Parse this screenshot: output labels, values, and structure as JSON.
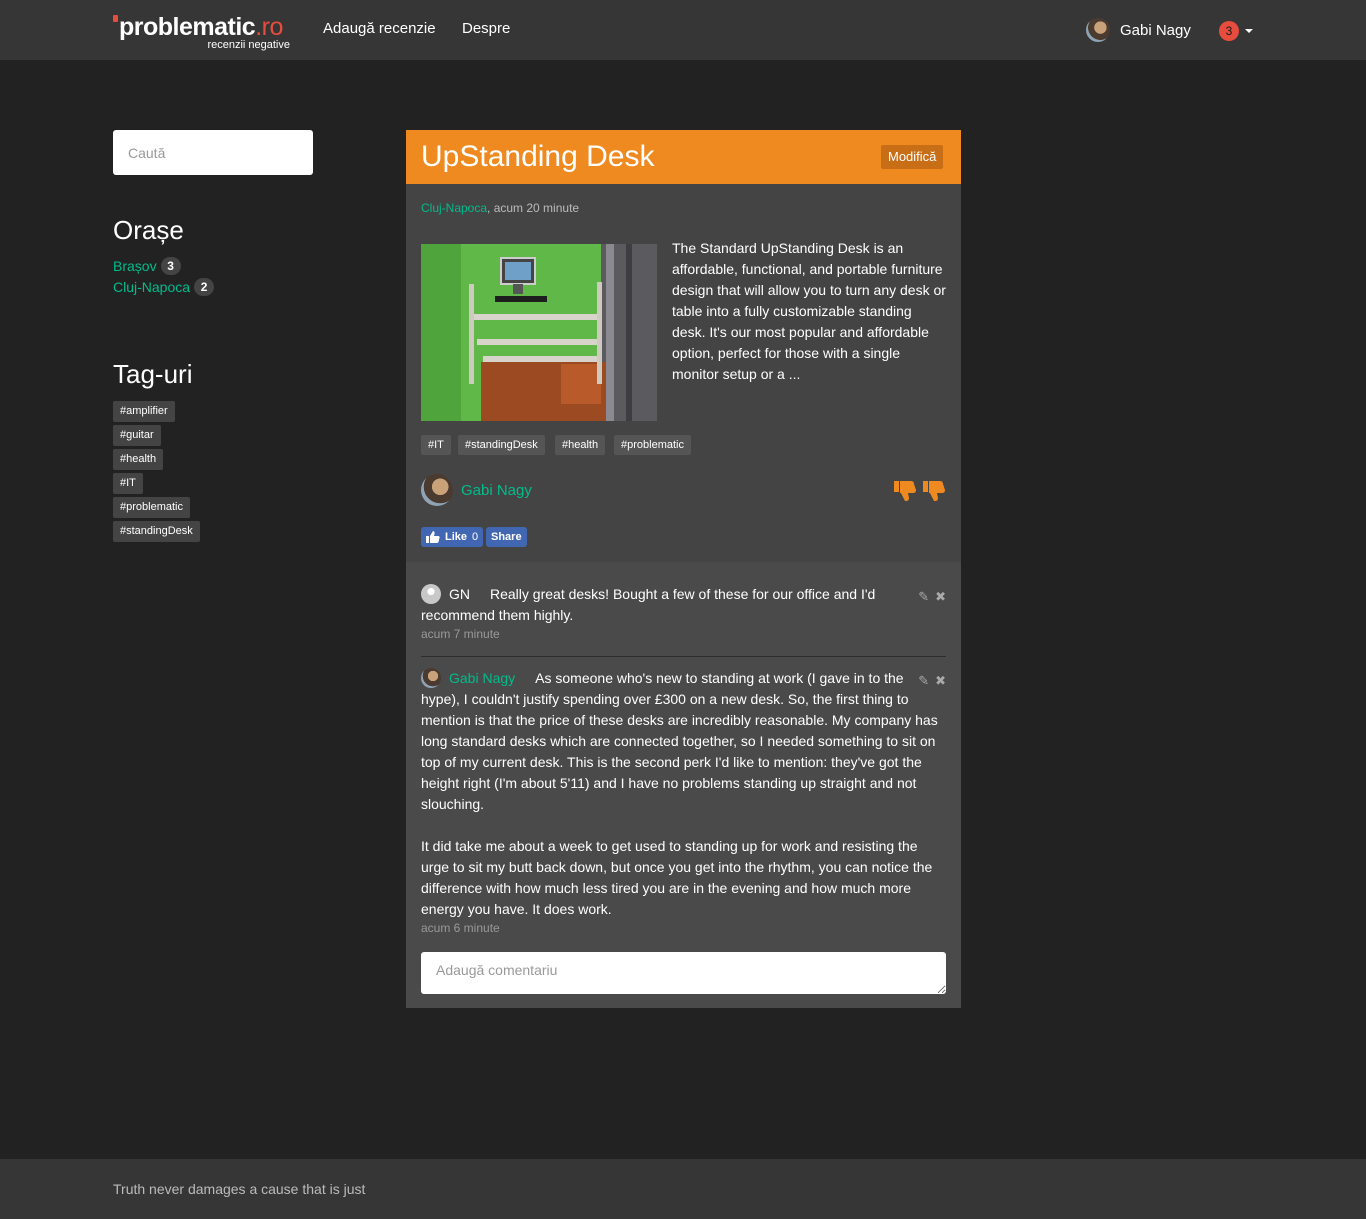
{
  "nav": {
    "brand_main": "problematic",
    "brand_tld": ".ro",
    "brand_sub": "recenzii negative",
    "links": [
      "Adaugă recenzie",
      "Despre"
    ],
    "user_name": "Gabi Nagy",
    "notification_count": "3"
  },
  "sidebar": {
    "search_placeholder": "Caută",
    "cities_title": "Orașe",
    "cities": [
      {
        "name": "Brașov",
        "count": "3"
      },
      {
        "name": "Cluj-Napoca",
        "count": "2"
      }
    ],
    "tags_title": "Tag-uri",
    "tags": [
      "#amplifier",
      "#guitar",
      "#health",
      "#IT",
      "#problematic",
      "#standingDesk"
    ]
  },
  "review": {
    "title": "UpStanding Desk",
    "edit_label": "Modifică",
    "location": "Cluj-Napoca",
    "time": ", acum 20 minute",
    "description": "The Standard UpStanding Desk is an affordable, functional, and portable furniture design that will allow you to turn any desk or table into a fully customizable standing desk. It's our most popular and affordable option, perfect for those with a single monitor setup or a ...",
    "tags": [
      "#IT",
      "#standingDesk",
      "#health",
      "#problematic"
    ],
    "author": "Gabi Nagy",
    "dislike_count": 2,
    "fb_like": "Like",
    "fb_like_count": "0",
    "fb_share": "Share"
  },
  "comments": {
    "items": [
      {
        "name": "GN",
        "text": "Really great desks! Bought a few of these for our office and I'd recommend them highly.",
        "time": "acum 7 minute"
      },
      {
        "name": "Gabi Nagy",
        "text": "As someone who's new to standing at work (I gave in to the hype), I couldn't justify spending over £300 on a new desk. So, the first thing to mention is that the price of these desks are incredibly reasonable. My company has long standard desks which are connected together, so I needed something to sit on top of my current desk. This is the second perk I'd like to mention: they've got the height right (I'm about 5'11) and I have no problems standing up straight and not slouching.",
        "text2": "It did take me about a week to get used to standing up for work and resisting the urge to sit my butt back down, but once you get into the rhythm, you can notice the difference with how much less tired you are in the evening and how much more energy you have. It does work.",
        "time": "acum 6 minute"
      }
    ],
    "add_placeholder": "Adaugă comentariu"
  },
  "footer": {
    "text": "Truth never damages a cause that is just"
  }
}
